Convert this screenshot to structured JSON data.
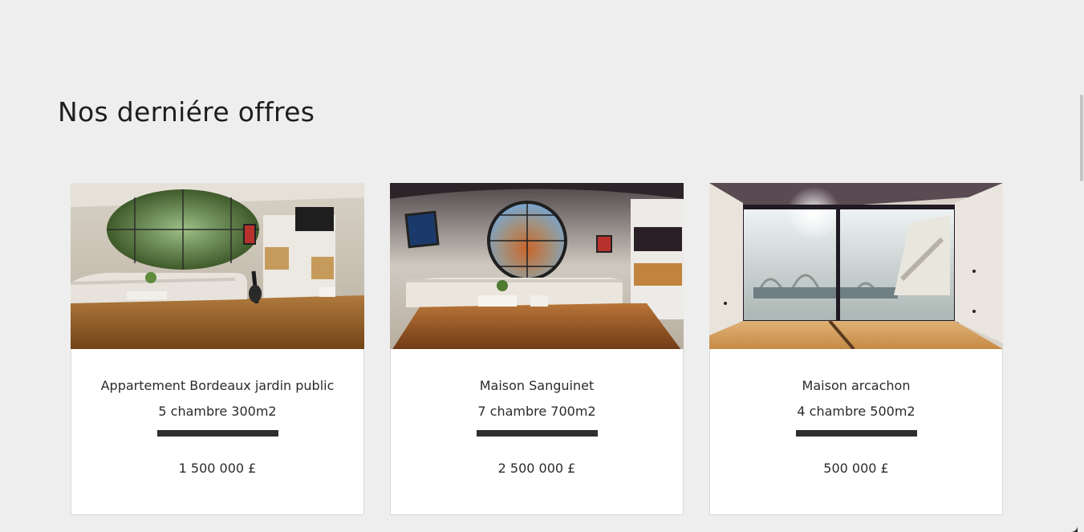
{
  "section": {
    "title": "Nos derniére offres"
  },
  "listings": [
    {
      "title": "Appartement Bordeaux jardin public",
      "details": "5 chambre 300m2",
      "price": "1 500 000 £"
    },
    {
      "title": "Maison Sanguinet",
      "details": "7 chambre 700m2",
      "price": "2 500 000 £"
    },
    {
      "title": "Maison arcachon",
      "details": "4 chambre 500m2",
      "price": "500 000 £"
    }
  ],
  "colors": {
    "background": "#eeeeee",
    "card": "#ffffff",
    "divider": "#2e2e2e"
  }
}
